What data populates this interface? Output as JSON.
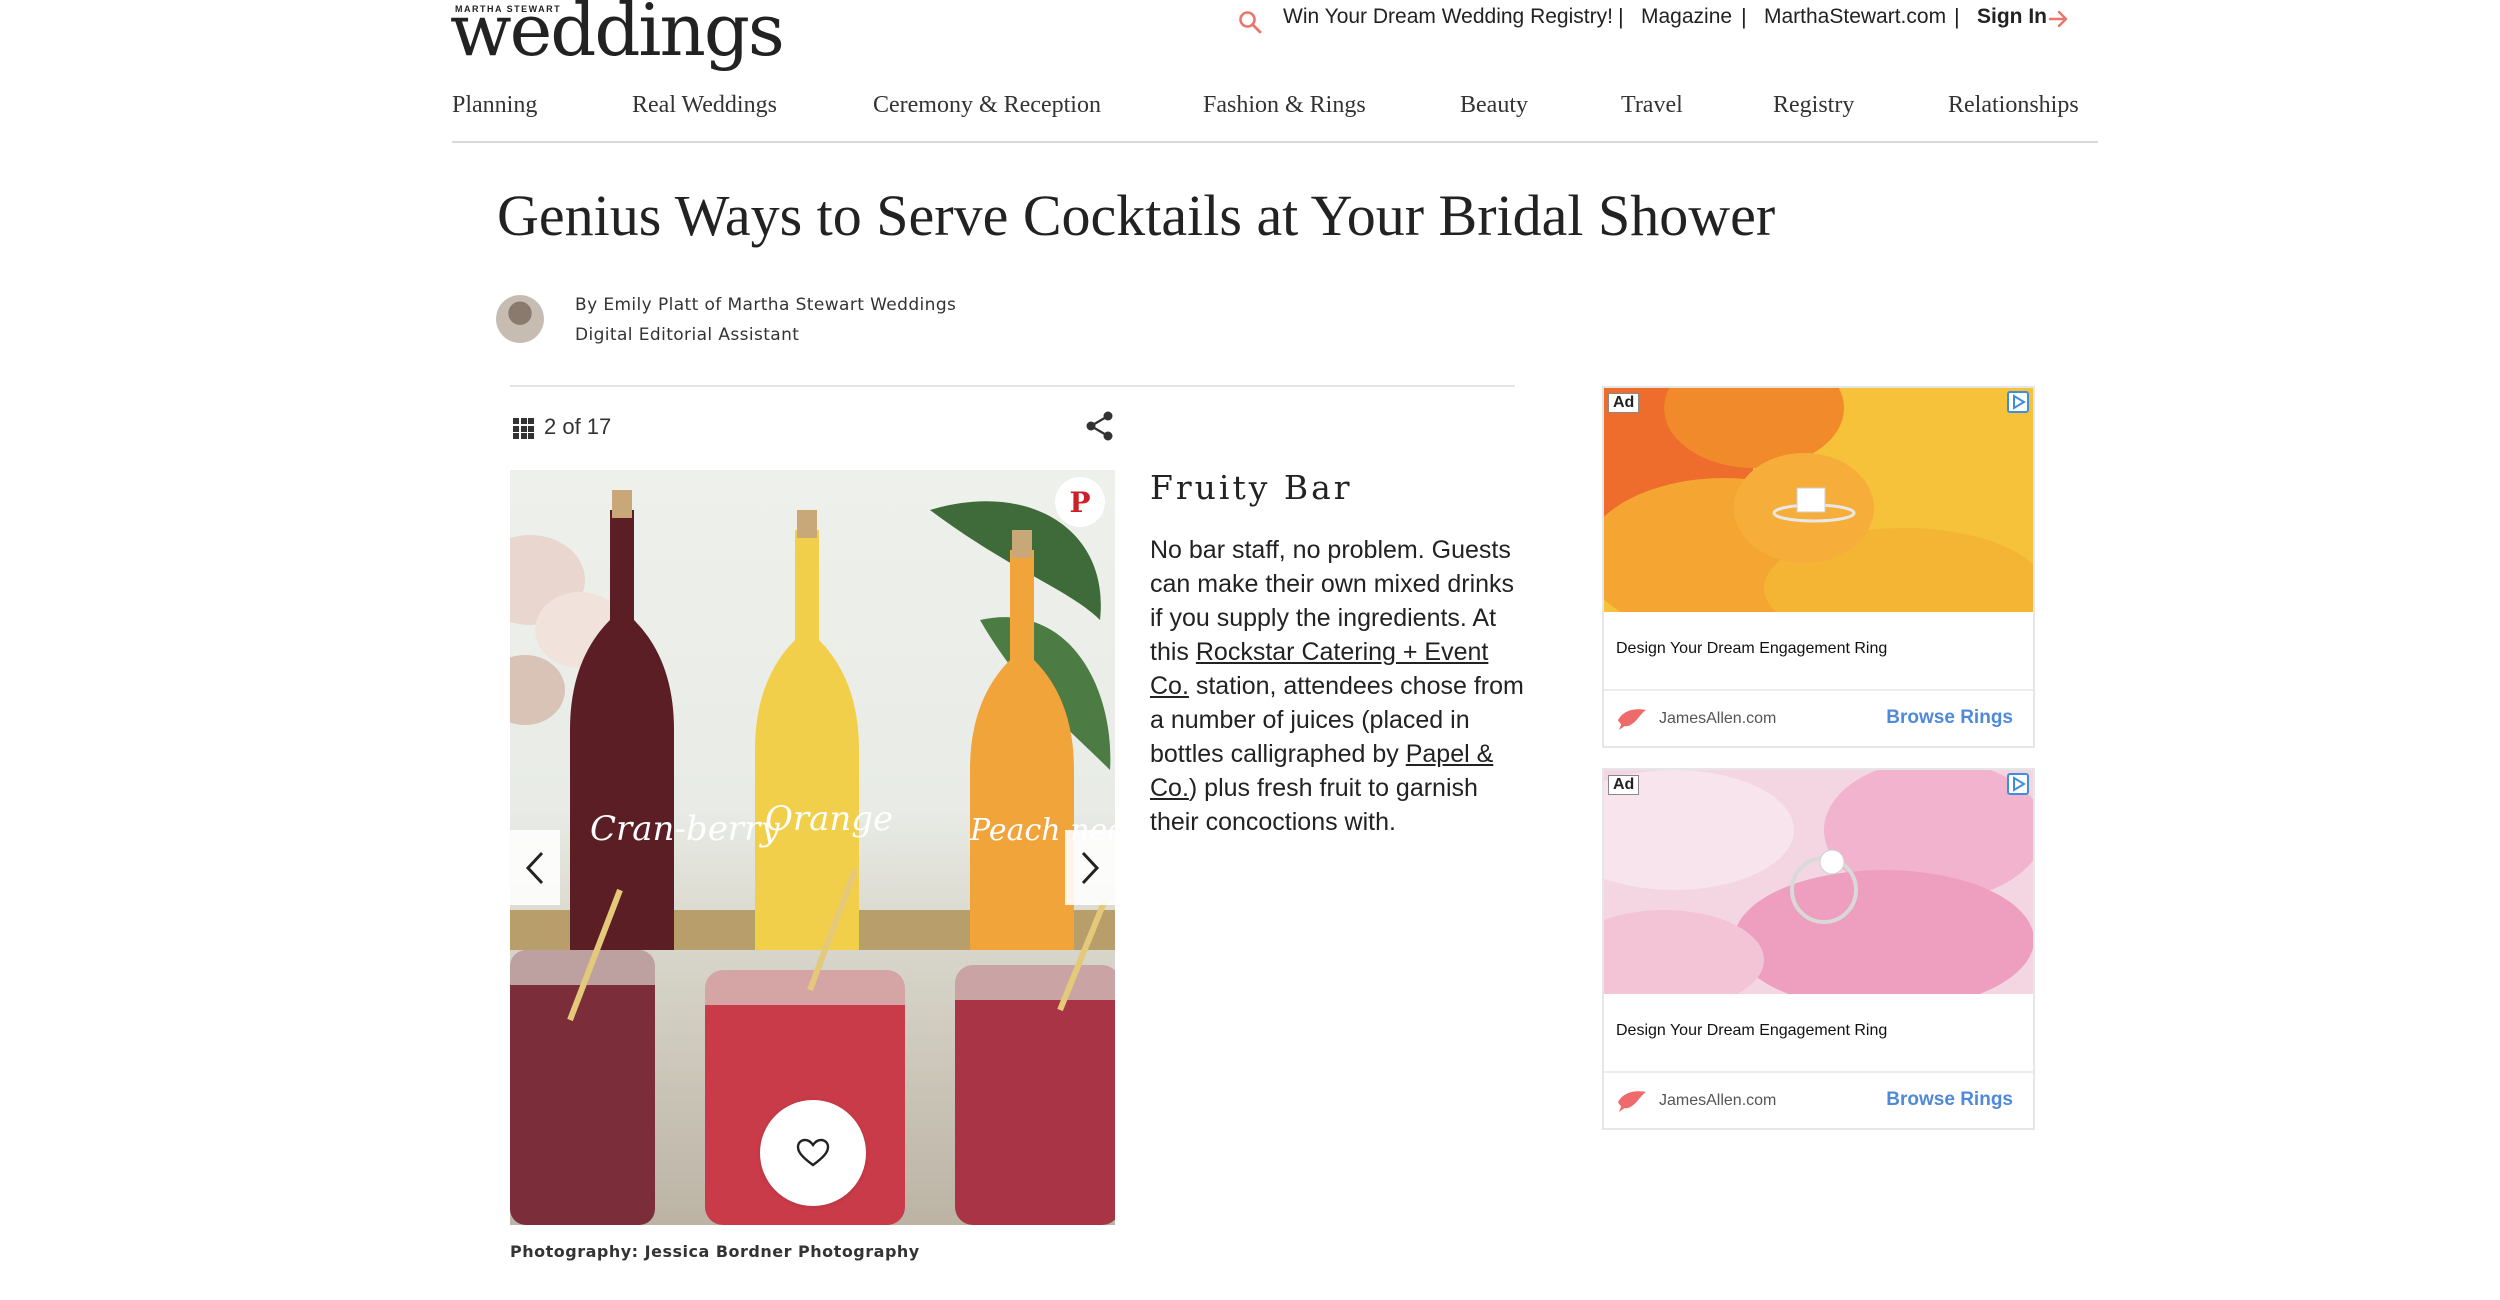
{
  "header": {
    "brand_small": "MARTHA STEWART",
    "logo": "weddings",
    "promo": "Win Your Dream Wedding Registry!",
    "links": [
      "Magazine",
      "MarthaStewart.com"
    ],
    "sign_in": "Sign In",
    "separator": "|"
  },
  "nav": [
    "Planning",
    "Real Weddings",
    "Ceremony & Reception",
    "Fashion & Rings",
    "Beauty",
    "Travel",
    "Registry",
    "Relationships"
  ],
  "article": {
    "title": "Genius Ways to Serve Cocktails at Your Bridal Shower",
    "byline": "By Emily Platt of Martha Stewart Weddings",
    "role": "Digital Editorial Assistant"
  },
  "slide": {
    "counter": "2 of 17",
    "title": "Fruity Bar",
    "body_part1": "No bar staff, no problem. Guests can make their own mixed drinks if you supply the ingredients. At this ",
    "link1": "Rockstar Catering + Event Co.",
    "body_part2": " station, attendees chose from a number of juices (placed in bottles calligraphed by ",
    "link2": "Papel & Co.",
    "body_part3": ") plus fresh fruit to garnish their concoctions with.",
    "credit": "Photography: Jessica Bordner Photography",
    "bottle_labels": [
      "Cran-berry",
      "Orange",
      "Peach nectar"
    ]
  },
  "ads": [
    {
      "tag": "Ad",
      "headline": "Design Your Dream Engagement Ring",
      "brand": "JamesAllen.com",
      "cta": "Browse Rings"
    },
    {
      "tag": "Ad",
      "headline": "Design Your Dream Engagement Ring",
      "brand": "JamesAllen.com",
      "cta": "Browse Rings"
    }
  ],
  "colors": {
    "accent_search": "#e9766b",
    "ad_cta": "#4f89d9",
    "pinterest": "#cb2027"
  },
  "icons": [
    "search-icon",
    "arrow-right-icon",
    "grid-icon",
    "share-icon",
    "pinterest-icon",
    "chevron-left-icon",
    "chevron-right-icon",
    "heart-icon",
    "adchoices-icon",
    "bird-logo-icon"
  ]
}
